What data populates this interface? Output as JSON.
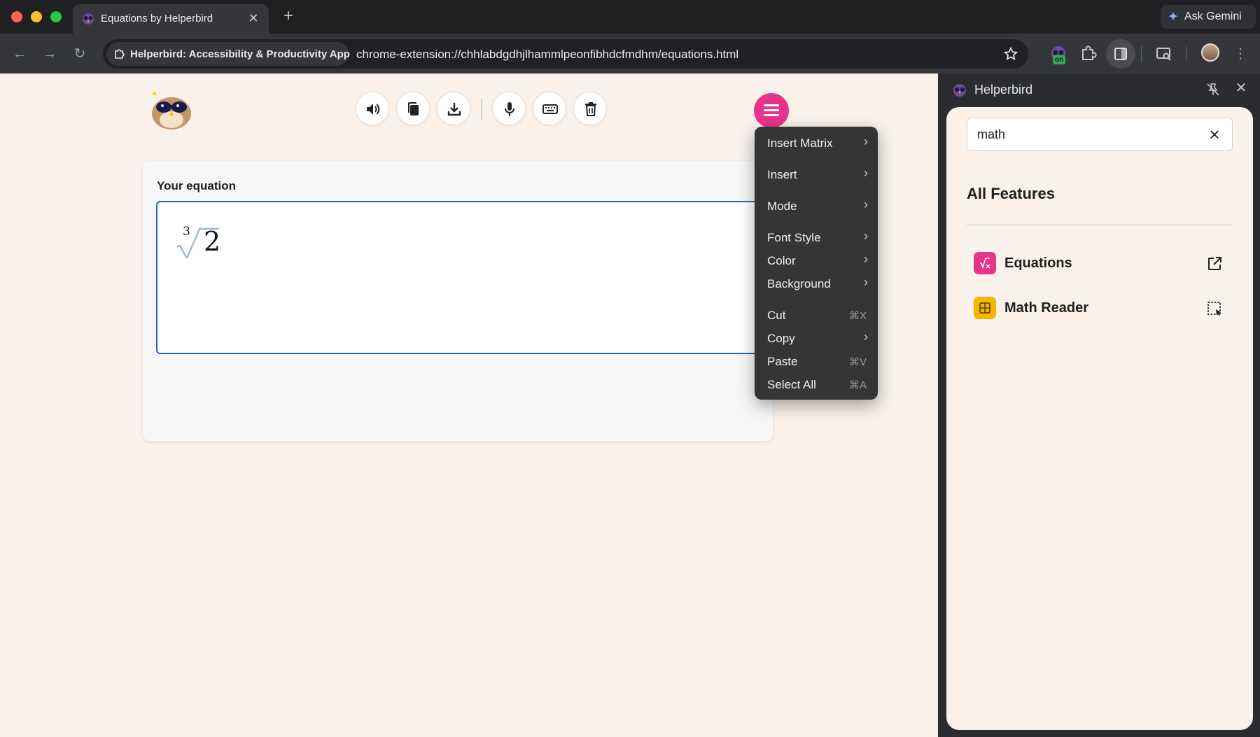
{
  "browser": {
    "tab": {
      "title": "Equations by Helperbird"
    },
    "gemini": {
      "label": "Ask Gemini"
    },
    "omnibox": {
      "site_chip": "Helperbird: Accessibility & Productivity App",
      "url": "chrome-extension://chhlabdgdhjlhammlpeonfibhdcfmdhm/equations.html"
    },
    "extension_badge": "on"
  },
  "page": {
    "equation_card": {
      "label": "Your equation",
      "math": {
        "index": "3",
        "radicand": "2"
      }
    },
    "actions": [
      "speaker-icon",
      "copy-icon",
      "download-icon",
      "microphone-icon",
      "keyboard-icon",
      "trash-icon"
    ],
    "accent_color": "#e8338a"
  },
  "context_menu": {
    "items": [
      {
        "label": "Insert Matrix",
        "submenu": true
      },
      {
        "label": "Insert",
        "submenu": true
      },
      {
        "label": "Mode",
        "submenu": true
      },
      {
        "label": "Font Style",
        "submenu": true
      },
      {
        "label": "Color",
        "submenu": true
      },
      {
        "label": "Background",
        "submenu": true
      },
      {
        "label": "Cut",
        "shortcut": "⌘X"
      },
      {
        "label": "Copy",
        "submenu": true
      },
      {
        "label": "Paste",
        "shortcut": "⌘V"
      },
      {
        "label": "Select All",
        "shortcut": "⌘A"
      }
    ]
  },
  "side_panel": {
    "title": "Helperbird",
    "search": {
      "value": "math"
    },
    "heading": "All Features",
    "features": [
      {
        "label": "Equations",
        "icon_color": "#e8338a",
        "action_icon": "open-external-icon"
      },
      {
        "label": "Math Reader",
        "icon_color": "#f4b400",
        "action_icon": "select-area-icon"
      }
    ]
  }
}
